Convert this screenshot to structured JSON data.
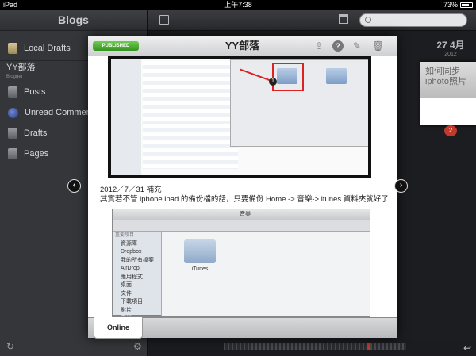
{
  "status_bar": {
    "carrier": "iPad",
    "time": "上午7:38",
    "battery": "73%"
  },
  "sidebar": {
    "title": "Blogs",
    "local_drafts": "Local Drafts",
    "blog_name": "YY部落",
    "blog_host": "Blogger",
    "items": [
      {
        "label": "Posts"
      },
      {
        "label": "Unread Comments"
      },
      {
        "label": "Drafts"
      },
      {
        "label": "Pages"
      }
    ]
  },
  "timeline": {
    "day_month": "27 4月",
    "year": "2012",
    "thumb_title": "如何同步iphoto照片",
    "thumb_badge": "2"
  },
  "modal": {
    "status_badge": "PUBLISHED",
    "title": "YY部落",
    "caption_date": "2012／7／31 補充",
    "caption_text": "其實若不管 iphone ipad 的備份檔的話，只要備份 Home -> 音樂-> itunes 資料夾就好了",
    "footer_tab": "Online",
    "screenshot2": {
      "window_title": "音樂",
      "folder_label": "iTunes",
      "sidebar_items": [
        "重要項目",
        "資源庫",
        "Dropbox",
        "我的所有檔案",
        "AirDrop",
        "應用程式",
        "桌面",
        "文件",
        "下載項目",
        "影片",
        "音樂"
      ]
    }
  },
  "colors": {
    "published_green": "#4caf32",
    "sidebar_bg": "#35363a",
    "badge_red": "#c0392b"
  }
}
